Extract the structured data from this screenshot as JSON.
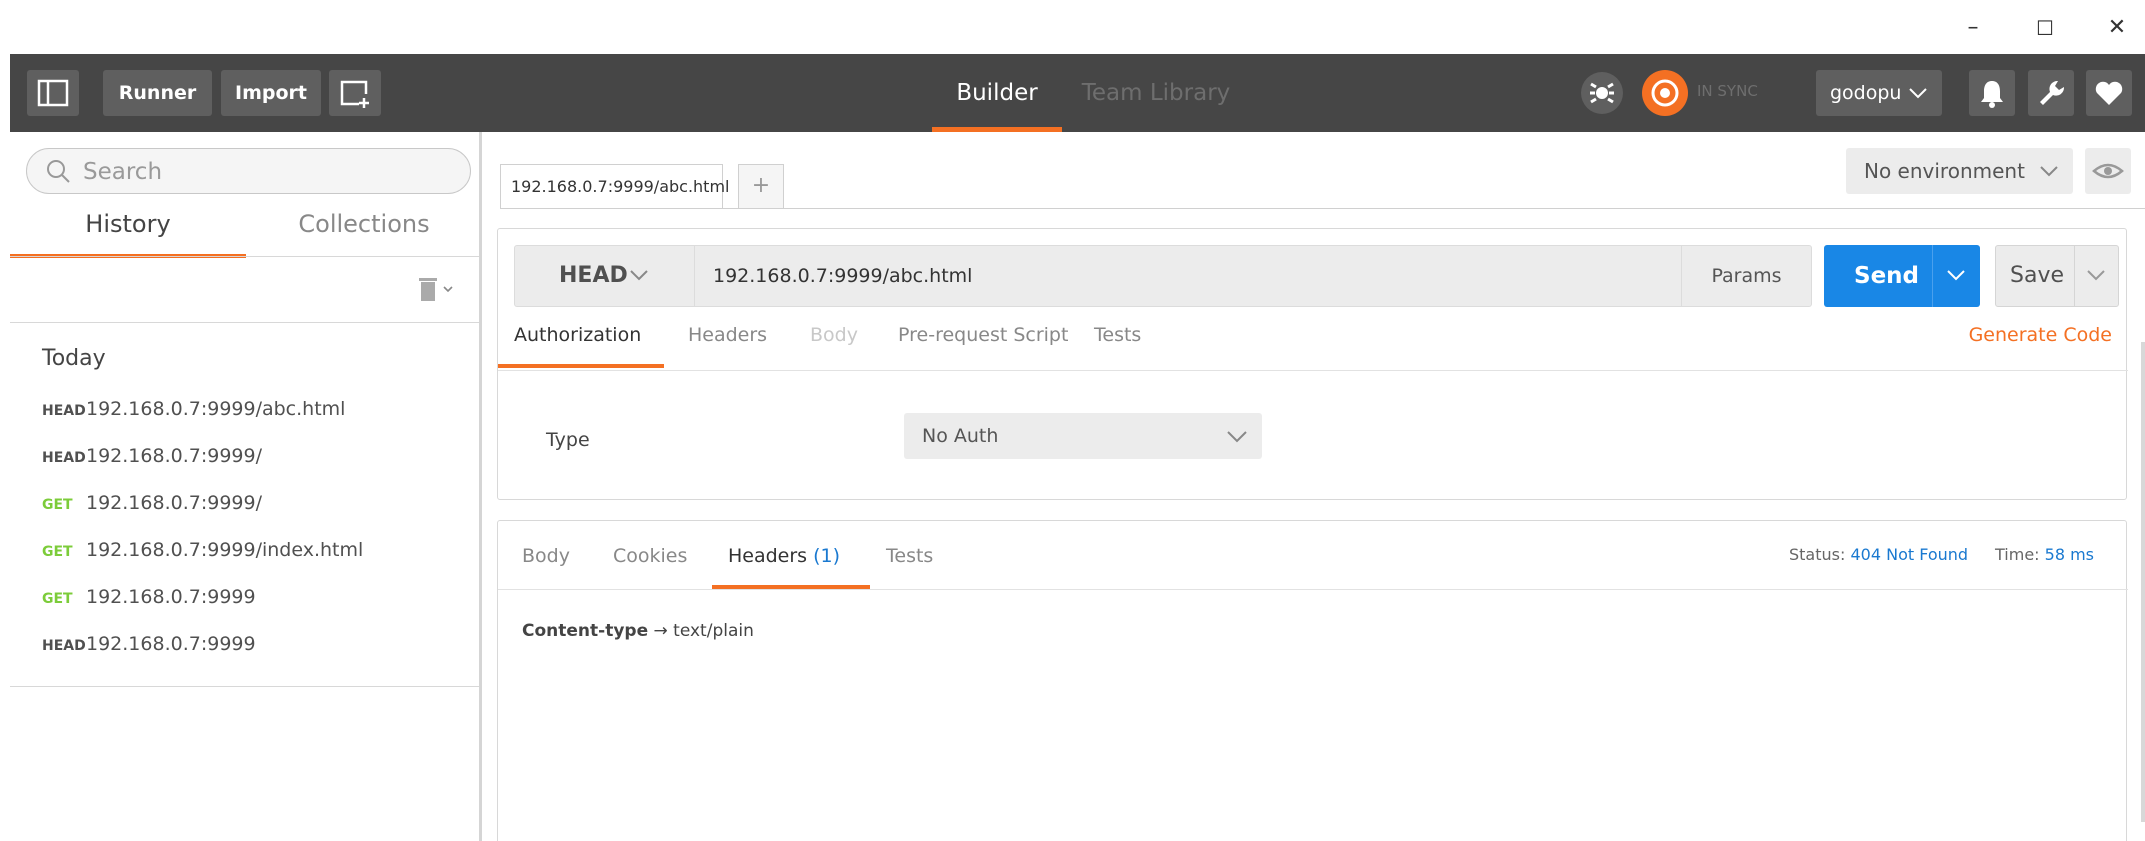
{
  "window_controls": {
    "minimize": "–",
    "maximize": "☐",
    "close": "✕"
  },
  "toolbar": {
    "runner_label": "Runner",
    "import_label": "Import",
    "tabs": [
      {
        "label": "Builder",
        "active": true
      },
      {
        "label": "Team Library",
        "active": false
      }
    ],
    "sync_status": "IN SYNC",
    "user": "godopu",
    "icons": [
      "sidebar-toggle-icon",
      "new-window-icon",
      "interceptor-icon",
      "sync-icon",
      "bell-icon",
      "wrench-icon",
      "heart-icon"
    ]
  },
  "sidebar": {
    "search_placeholder": "Search",
    "tabs": [
      {
        "label": "History",
        "active": true
      },
      {
        "label": "Collections",
        "active": false
      }
    ],
    "group_label": "Today",
    "history": [
      {
        "method": "HEAD",
        "url": "192.168.0.7:9999/abc.html"
      },
      {
        "method": "HEAD",
        "url": "192.168.0.7:9999/"
      },
      {
        "method": "GET",
        "url": "192.168.0.7:9999/"
      },
      {
        "method": "GET",
        "url": "192.168.0.7:9999/index.html"
      },
      {
        "method": "GET",
        "url": "192.168.0.7:9999"
      },
      {
        "method": "HEAD",
        "url": "192.168.0.7:9999"
      }
    ]
  },
  "request": {
    "tab_label": "192.168.0.7:9999/abc.html",
    "add_tab": "+",
    "environment": "No environment",
    "method": "HEAD",
    "url": "192.168.0.7:9999/abc.html",
    "params_label": "Params",
    "send_label": "Send",
    "save_label": "Save",
    "sub_tabs": [
      {
        "label": "Authorization",
        "state": "active"
      },
      {
        "label": "Headers",
        "state": "normal"
      },
      {
        "label": "Body",
        "state": "disabled"
      },
      {
        "label": "Pre-request Script",
        "state": "normal"
      },
      {
        "label": "Tests",
        "state": "normal"
      }
    ],
    "generate_code_label": "Generate Code",
    "type_label": "Type",
    "auth_type": "No Auth"
  },
  "response": {
    "tabs": [
      {
        "label": "Body",
        "active": false
      },
      {
        "label": "Cookies",
        "active": false
      },
      {
        "label": "Headers",
        "count": "(1)",
        "active": true
      },
      {
        "label": "Tests",
        "active": false
      }
    ],
    "status_label": "Status:",
    "status_value": "404 Not Found",
    "time_label": "Time:",
    "time_value": "58 ms",
    "headers": [
      {
        "key": "Content-type",
        "arrow": "→",
        "value": "text/plain"
      }
    ]
  },
  "colors": {
    "accent": "#f47023",
    "send_blue": "#1987e6",
    "get_green": "#7ccc3a",
    "toolbar_bg": "#464646",
    "link_blue": "#1a79d0"
  }
}
